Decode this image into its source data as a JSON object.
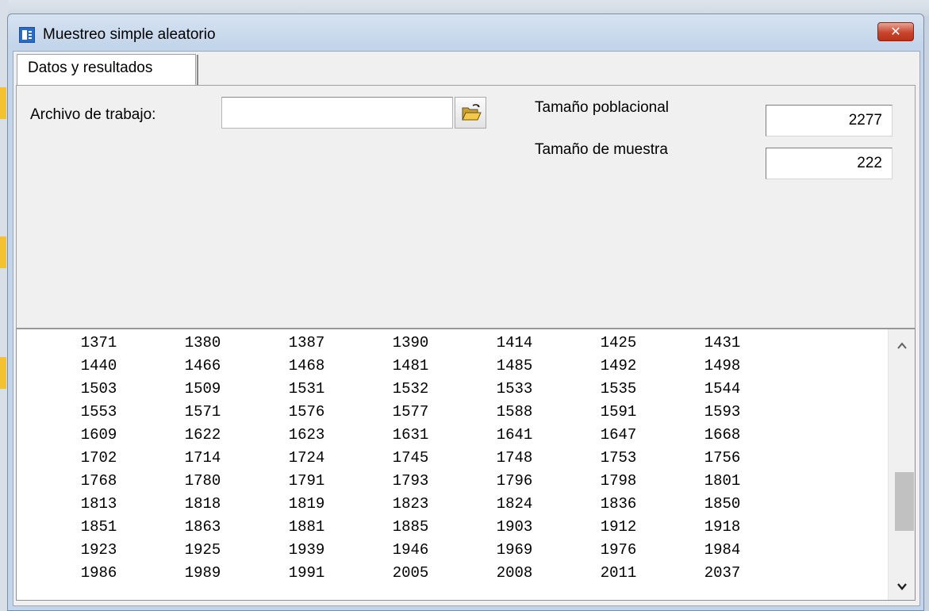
{
  "window": {
    "title": "Muestreo simple aleatorio",
    "close_label": "✕"
  },
  "tabs": [
    {
      "label": "Datos y resultados",
      "selected": true
    }
  ],
  "form": {
    "archivo_label": "Archivo de trabajo:",
    "archivo_value": "",
    "poblacional_label": "Tamaño poblacional",
    "poblacional_value": "2277",
    "muestra_label": "Tamaño de muestra",
    "muestra_value": "222"
  },
  "results": {
    "rows": [
      [
        "1371",
        "1380",
        "1387",
        "1390",
        "1414",
        "1425",
        "1431"
      ],
      [
        "1440",
        "1466",
        "1468",
        "1481",
        "1485",
        "1492",
        "1498"
      ],
      [
        "1503",
        "1509",
        "1531",
        "1532",
        "1533",
        "1535",
        "1544"
      ],
      [
        "1553",
        "1571",
        "1576",
        "1577",
        "1588",
        "1591",
        "1593"
      ],
      [
        "1609",
        "1622",
        "1623",
        "1631",
        "1641",
        "1647",
        "1668"
      ],
      [
        "1702",
        "1714",
        "1724",
        "1745",
        "1748",
        "1753",
        "1756"
      ],
      [
        "1768",
        "1780",
        "1791",
        "1793",
        "1796",
        "1798",
        "1801"
      ],
      [
        "1813",
        "1818",
        "1819",
        "1823",
        "1824",
        "1836",
        "1850"
      ],
      [
        "1851",
        "1863",
        "1881",
        "1885",
        "1903",
        "1912",
        "1918"
      ],
      [
        "1923",
        "1925",
        "1939",
        "1946",
        "1969",
        "1976",
        "1984"
      ],
      [
        "1986",
        "1989",
        "1991",
        "2005",
        "2008",
        "2011",
        "2037"
      ]
    ]
  },
  "icons": {
    "app": "statistics-app-icon",
    "open_folder": "open-folder-icon",
    "scroll_up": "chevron-up-icon",
    "scroll_down": "chevron-down-icon"
  },
  "colors": {
    "close_button": "#c9442c",
    "title_bar": "#c3d5ea",
    "folder": "#e9b92c"
  }
}
